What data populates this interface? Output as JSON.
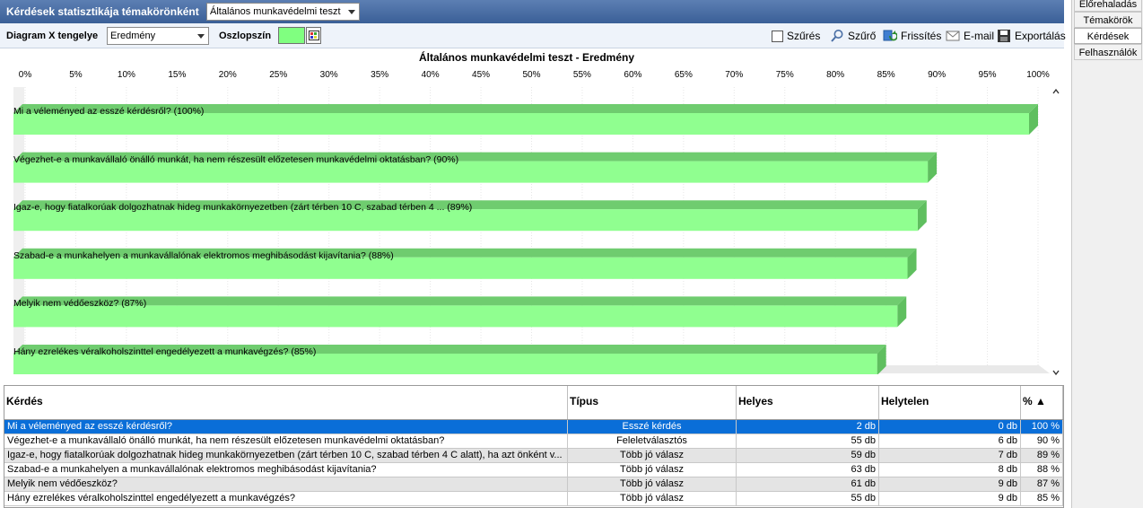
{
  "window": {
    "title": "Kérdések statisztikája témakörönként",
    "topic_select": "Általános munkavédelmi teszt"
  },
  "toolbar": {
    "xaxis_label": "Diagram X tengelye",
    "xaxis_value": "Eredmény",
    "bar_color_label": "Oszlopszín",
    "bar_color": "#80ff80",
    "filter_check": "Szűrés",
    "filter_button": "Szűrő",
    "refresh": "Frissítés",
    "email": "E-mail",
    "export": "Exportálás"
  },
  "side_tabs": [
    "Előrehaladás",
    "Témakörök",
    "Kérdések",
    "Felhasználók"
  ],
  "side_active": 2,
  "chart_data": {
    "type": "bar",
    "orientation": "horizontal",
    "title": "Általános munkavédelmi teszt - Eredmény",
    "ticks": [
      "0%",
      "5%",
      "10%",
      "15%",
      "20%",
      "25%",
      "30%",
      "35%",
      "40%",
      "45%",
      "50%",
      "55%",
      "60%",
      "65%",
      "70%",
      "75%",
      "80%",
      "85%",
      "90%",
      "95%",
      "100%"
    ],
    "xlim": [
      0,
      100
    ],
    "categories": [
      "Mi a véleményed az esszé kérdésről? (100%)",
      "Végezhet-e a munkavállaló önálló  munkát, ha nem részesült előzetesen munkavédelmi oktatásban? (90%)",
      "Igaz-e, hogy fiatalkorúak dolgozhatnak hideg munkakörnyezetben (zárt térben 10 C, szabad térben 4 ... (89%)",
      "Szabad-e a munkahelyen a munkavállalónak elektromos meghibásodást kijavítania? (88%)",
      "Melyik nem védőeszköz? (87%)",
      "Hány ezrelékes véralkoholszinttel engedélyezett a munkavégzés? (85%)"
    ],
    "values": [
      100,
      90,
      89,
      88,
      87,
      85
    ],
    "bar_color": "#90ff90",
    "bar_edge_color": "#6fcc6f"
  },
  "table": {
    "headers": [
      "Kérdés",
      "Típus",
      "Helyes",
      "Helytelen",
      "% ▲"
    ],
    "rows": [
      [
        "Mi a véleményed az esszé kérdésről?",
        "Esszé kérdés",
        "2 db",
        "0 db",
        "100 %"
      ],
      [
        "Végezhet-e a munkavállaló önálló  munkát, ha nem részesült előzetesen munkavédelmi oktatásban?",
        "Feleletválasztós",
        "55 db",
        "6 db",
        "90 %"
      ],
      [
        "Igaz-e, hogy fiatalkorúak dolgozhatnak hideg munkakörnyezetben (zárt térben 10 C, szabad térben 4 C alatt), ha azt önként v...",
        "Több jó válasz",
        "59 db",
        "7 db",
        "89 %"
      ],
      [
        "Szabad-e a munkahelyen a munkavállalónak elektromos meghibásodást kijavítania?",
        "Több jó válasz",
        "63 db",
        "8 db",
        "88 %"
      ],
      [
        "Melyik nem védőeszköz?",
        "Több jó válasz",
        "61 db",
        "9 db",
        "87 %"
      ],
      [
        "Hány ezrelékes véralkoholszinttel engedélyezett a munkavégzés?",
        "Több jó válasz",
        "55 db",
        "9 db",
        "85 %"
      ]
    ],
    "selected_row": 0
  }
}
